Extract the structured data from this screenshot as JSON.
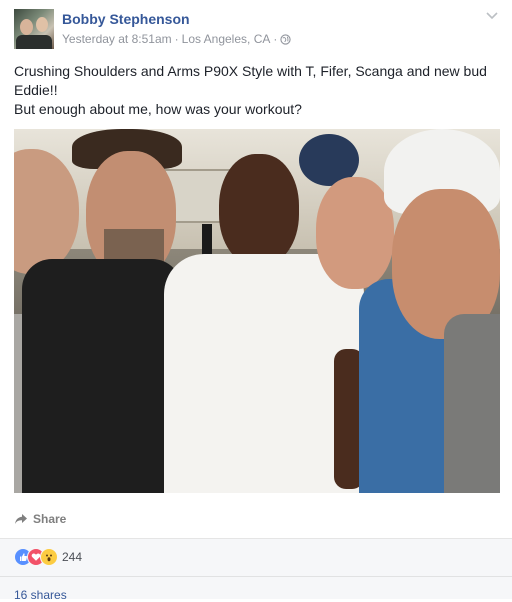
{
  "post": {
    "author": "Bobby Stephenson",
    "timestamp": "Yesterday at 8:51am",
    "separator": "·",
    "location": "Los Angeles, CA",
    "text_lines": [
      "Crushing Shoulders and Arms P90X Style with T, Fifer, Scanga and new bud Eddie!!",
      "But enough about me, how was your workout?"
    ]
  },
  "actions": {
    "share_label": "Share"
  },
  "reactions": {
    "types": [
      "like-icon",
      "love-icon",
      "wow-icon"
    ],
    "count": "244"
  },
  "shares": {
    "label": "16 shares"
  },
  "colors": {
    "link": "#365899",
    "meta": "#90949c",
    "like": "#5890ff",
    "love": "#f25268",
    "wow": "#fccc42"
  }
}
